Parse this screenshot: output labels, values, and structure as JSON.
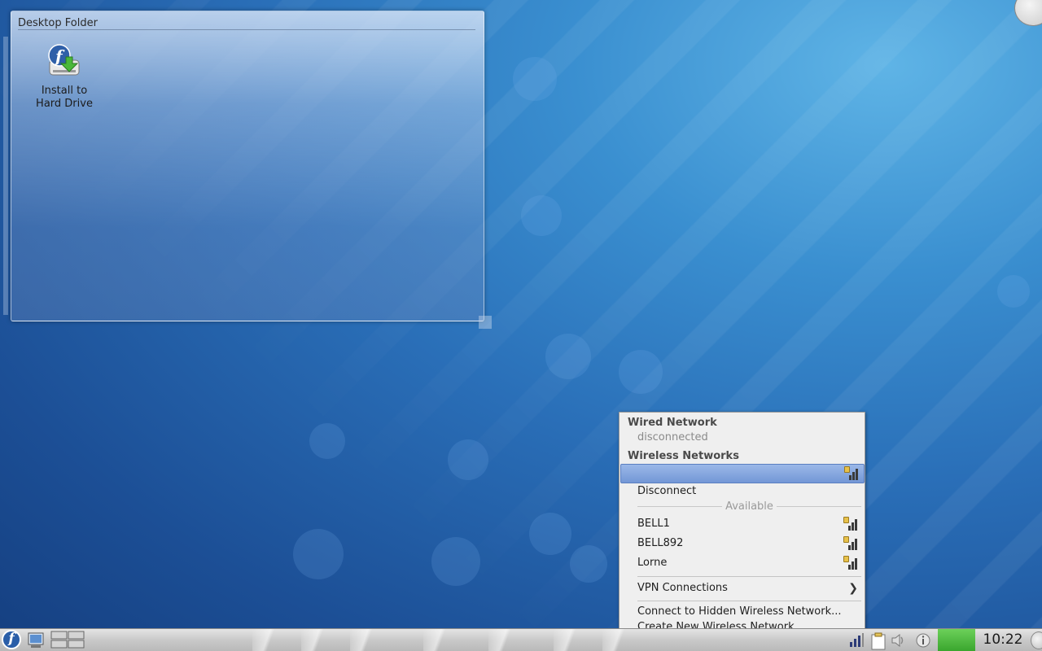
{
  "desktop": {
    "folder_title": "Desktop Folder",
    "icons": [
      {
        "label": "Install to\nHard Drive",
        "icon": "fedora-install-icon"
      }
    ]
  },
  "network_menu": {
    "wired_header": "Wired Network",
    "wired_status": "disconnected",
    "wireless_header": "Wireless Networks",
    "active_network": "",
    "disconnect_label": "Disconnect",
    "available_label": "Available",
    "networks": [
      {
        "ssid": "BELL1",
        "secured": true
      },
      {
        "ssid": "BELL892",
        "secured": true
      },
      {
        "ssid": "Lorne",
        "secured": true
      }
    ],
    "vpn_label": "VPN Connections",
    "connect_hidden_label": "Connect to Hidden Wireless Network...",
    "create_new_label": "Create New Wireless Network..."
  },
  "taskbar": {
    "clock": "10:22",
    "launcher_icon": "fedora-kickoff-icon",
    "tray_icons": [
      "network-signal-icon",
      "klipper-clipboard-icon",
      "volume-icon",
      "info-icon"
    ]
  },
  "colors": {
    "menu_highlight": "#7397d6",
    "taskbar_green": "#3aa62e",
    "wallpaper_blue": "#2a6fb8"
  }
}
